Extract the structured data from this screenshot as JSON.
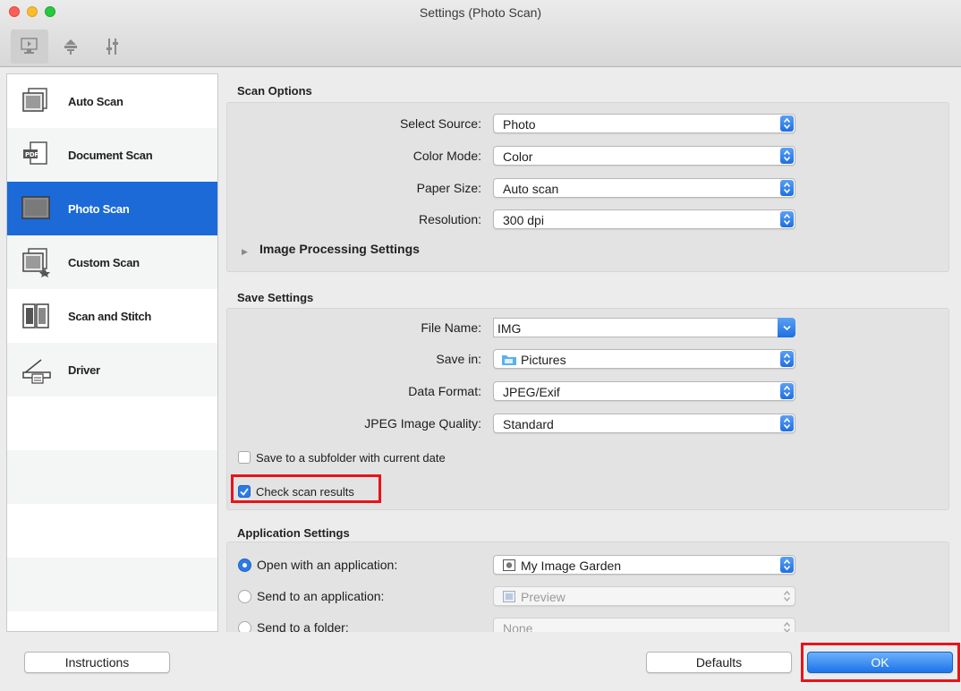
{
  "window": {
    "title": "Settings (Photo Scan)"
  },
  "toolbar": {
    "icons": [
      "scan-from-computer-icon",
      "scan-from-panel-icon",
      "general-settings-icon"
    ]
  },
  "sidebar": {
    "items": [
      {
        "label": "Auto Scan",
        "icon": "auto-scan-icon",
        "selected": false
      },
      {
        "label": "Document Scan",
        "icon": "document-scan-icon",
        "selected": false
      },
      {
        "label": "Photo Scan",
        "icon": "photo-scan-icon",
        "selected": true
      },
      {
        "label": "Custom Scan",
        "icon": "custom-scan-icon",
        "selected": false
      },
      {
        "label": "Scan and Stitch",
        "icon": "scan-and-stitch-icon",
        "selected": false
      },
      {
        "label": "Driver",
        "icon": "driver-icon",
        "selected": false
      }
    ]
  },
  "scan_options": {
    "title": "Scan Options",
    "select_source": {
      "label": "Select Source:",
      "value": "Photo"
    },
    "color_mode": {
      "label": "Color Mode:",
      "value": "Color"
    },
    "paper_size": {
      "label": "Paper Size:",
      "value": "Auto scan"
    },
    "resolution": {
      "label": "Resolution:",
      "value": "300 dpi"
    },
    "image_processing": {
      "label": "Image Processing Settings",
      "expanded": false
    }
  },
  "save_settings": {
    "title": "Save Settings",
    "file_name": {
      "label": "File Name:",
      "value": "IMG"
    },
    "save_in": {
      "label": "Save in:",
      "value": "Pictures"
    },
    "data_format": {
      "label": "Data Format:",
      "value": "JPEG/Exif"
    },
    "jpeg_quality": {
      "label": "JPEG Image Quality:",
      "value": "Standard"
    },
    "subfolder": {
      "label": "Save to a subfolder with current date",
      "checked": false
    },
    "check_results": {
      "label": "Check scan results",
      "checked": true
    }
  },
  "application_settings": {
    "title": "Application Settings",
    "open_with": {
      "label": "Open with an application:",
      "value": "My Image Garden",
      "selected": true
    },
    "send_to_app": {
      "label": "Send to an application:",
      "value": "Preview",
      "selected": false
    },
    "send_to_folder": {
      "label": "Send to a folder:",
      "value": "None",
      "selected": false
    }
  },
  "footer": {
    "instructions_label": "Instructions",
    "defaults_label": "Defaults",
    "ok_label": "OK"
  },
  "colors": {
    "accent": "#1b6ad8",
    "highlight": "#e8131b"
  }
}
